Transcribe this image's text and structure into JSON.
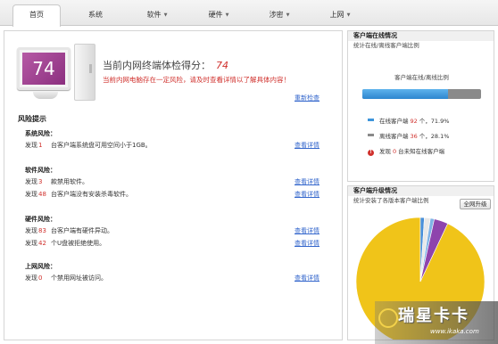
{
  "nav": {
    "tabs": [
      {
        "label": "首页",
        "dropdown": false
      },
      {
        "label": "系统",
        "dropdown": false
      },
      {
        "label": "软件",
        "dropdown": true
      },
      {
        "label": "硬件",
        "dropdown": true
      },
      {
        "label": "涉密",
        "dropdown": true
      },
      {
        "label": "上网",
        "dropdown": true
      }
    ],
    "active": "首页"
  },
  "summary": {
    "score_label": "当前内网终端体检得分：",
    "score": "74",
    "screen_score": "74",
    "warning": "当前内网电脑存在一定风险，请及时查看详情以了解具体内容！",
    "recheck_label": "重新检查"
  },
  "risk": {
    "title": "风险提示",
    "view_details_label": "查看详情",
    "groups": [
      {
        "title": "系统风险：",
        "rows": [
          {
            "prefix": "发现",
            "count": "1",
            "text": "台客户端系统盘可用空间小于1GB。"
          }
        ]
      },
      {
        "title": "软件风险：",
        "rows": [
          {
            "prefix": "发现",
            "count": "3",
            "text": "款禁用软件。"
          },
          {
            "prefix": "发现",
            "count": "48",
            "text": "台客户端没有安装杀毒软件。"
          }
        ]
      },
      {
        "title": "硬件风险：",
        "rows": [
          {
            "prefix": "发现",
            "count": "83",
            "text": "台客户端有硬件异动。"
          },
          {
            "prefix": "发现",
            "count": "42",
            "text": "个U盘被拒绝使用。"
          }
        ]
      },
      {
        "title": "上网风险：",
        "rows": [
          {
            "prefix": "发现",
            "count": "0",
            "text": "个禁用网址被访问。"
          }
        ]
      }
    ]
  },
  "online_panel": {
    "title": "客户端在线情况",
    "subtitle": "统计在线/离线客户端比例",
    "chart_label": "客户端在线/离线比例",
    "online": {
      "label": "在线客户端",
      "count": "92",
      "unit": "个，",
      "percent_text": "71.9%"
    },
    "offline": {
      "label": "离线客户端",
      "count": "36",
      "unit": "个，",
      "percent_text": "28.1%"
    },
    "unknown": {
      "prefix": "发现",
      "count": "0",
      "text": "台未知在线客户端"
    },
    "colors": {
      "online": "#3d95db",
      "offline": "#8a8a8a",
      "alert": "#d0312d"
    }
  },
  "upgrade_panel": {
    "title": "客户端升级情况",
    "subtitle": "统计安装了各版本客户端比例",
    "button_label": "全网升级"
  },
  "chart_data": {
    "type": "pie",
    "title": "",
    "values": [
      93,
      1,
      1.5,
      1,
      3.5
    ],
    "colors": [
      "#f0c419",
      "#4a90d9",
      "#e8e8e8",
      "#7fb3e6",
      "#8e44ad"
    ]
  },
  "watermark": {
    "text": "瑞星卡卡",
    "url": "www.ikaka.com"
  }
}
